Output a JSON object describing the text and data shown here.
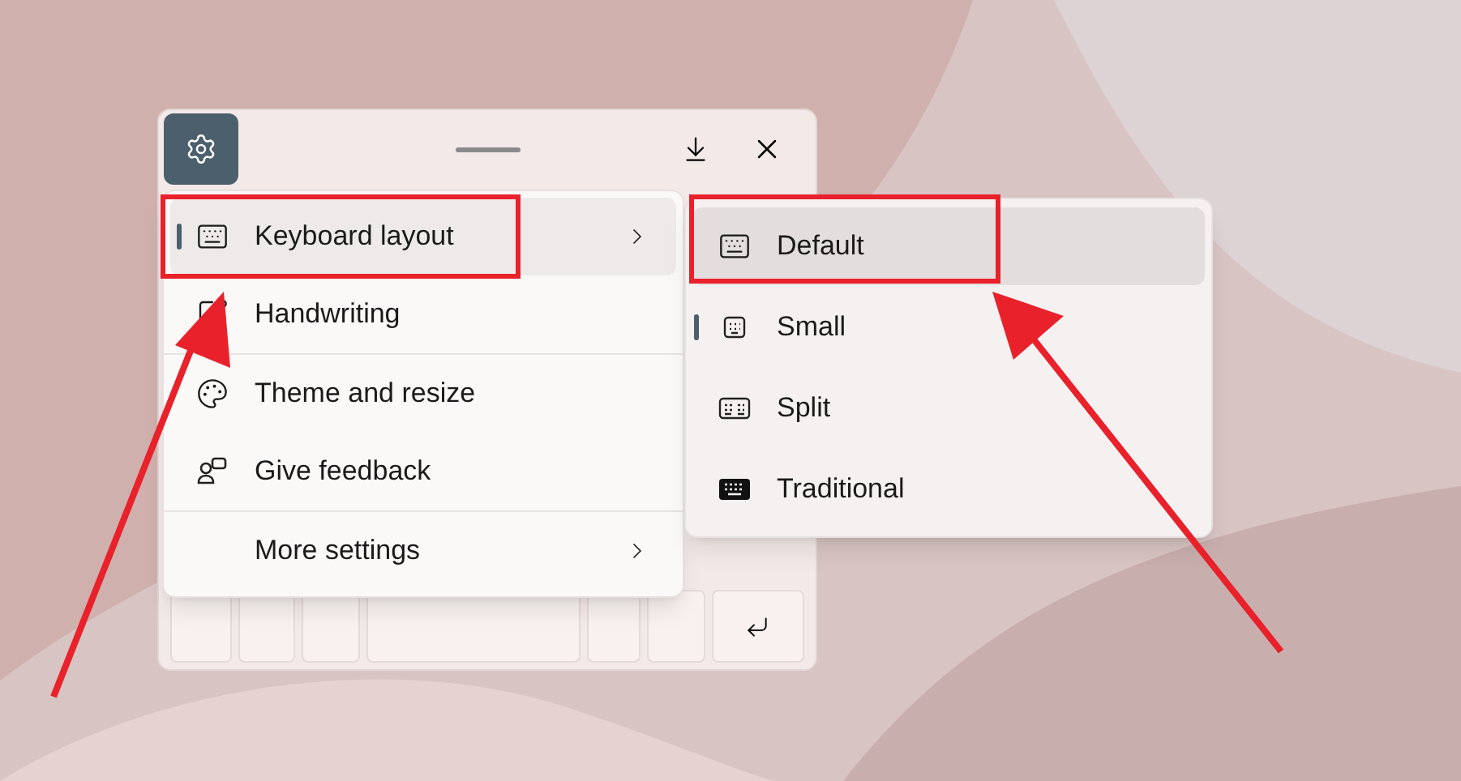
{
  "menu": {
    "items": [
      {
        "label": "Keyboard layout",
        "selected": true,
        "hovered": true,
        "has_submenu": true
      },
      {
        "label": "Handwriting",
        "selected": false,
        "hovered": false,
        "has_submenu": false
      },
      {
        "label": "Theme and resize",
        "selected": false,
        "hovered": false,
        "has_submenu": false
      },
      {
        "label": "Give feedback",
        "selected": false,
        "hovered": false,
        "has_submenu": false
      },
      {
        "label": "More settings",
        "selected": false,
        "hovered": false,
        "has_submenu": true
      }
    ]
  },
  "submenu": {
    "items": [
      {
        "label": "Default",
        "selected": false,
        "hovered": true
      },
      {
        "label": "Small",
        "selected": true,
        "hovered": false
      },
      {
        "label": "Split",
        "selected": false,
        "hovered": false
      },
      {
        "label": "Traditional",
        "selected": false,
        "hovered": false
      }
    ]
  }
}
